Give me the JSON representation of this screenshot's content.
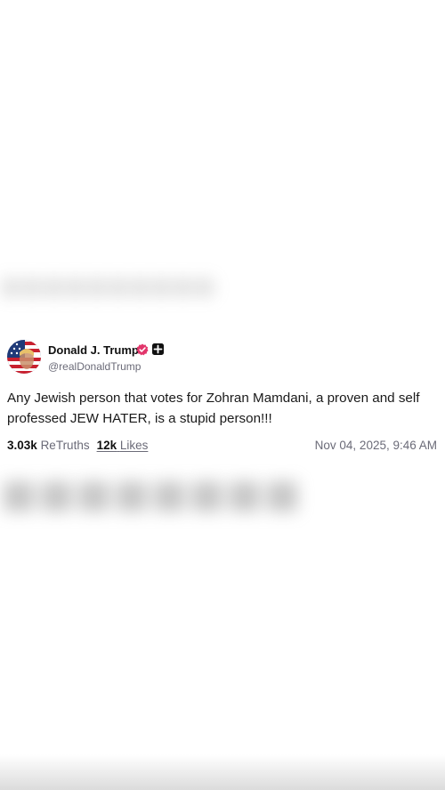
{
  "post": {
    "author_name": "Donald J. Trump",
    "author_handle": "@realDonaldTrump",
    "text": "Any Jewish person that votes for Zohran Mamdani, a proven and self professed JEW HATER, is a stupid person!!!",
    "retruths_count": "3.03k",
    "retruths_label": "ReTruths",
    "likes_count": "12k",
    "likes_label": "Likes",
    "timestamp": "Nov 04, 2025, 9:46 AM"
  },
  "icons": {
    "verified": "verified-badge-icon",
    "bot": "bot-badge-icon",
    "avatar": "avatar"
  },
  "colors": {
    "verified_badge": "#e2356b",
    "bot_badge": "#111111",
    "handle_gray": "#6b6b78",
    "text": "#1a1a1a"
  }
}
